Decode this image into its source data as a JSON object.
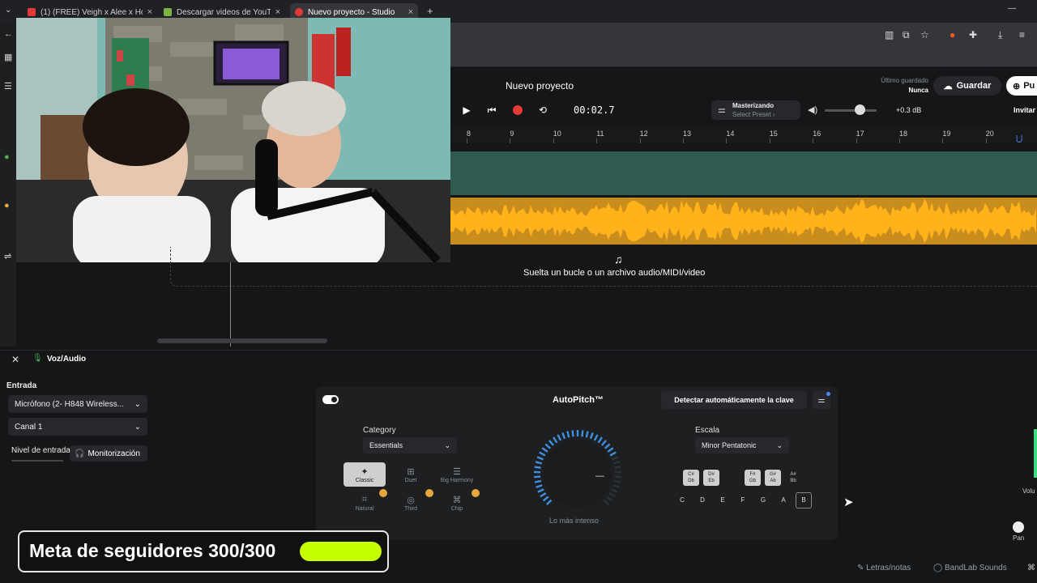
{
  "browser": {
    "tabs": [
      {
        "title": "(1) (FREE) Veigh x Alee x Hoodtr...",
        "close": "×"
      },
      {
        "title": "Descargar videos de YouTube - ...",
        "close": "×"
      },
      {
        "title": "Nuevo proyecto - Studio",
        "close": "×"
      }
    ],
    "new_tab": "+",
    "menu_arrow": "⌄",
    "minimize": "—"
  },
  "daw": {
    "project_title": "Nuevo proyecto",
    "time": "00:02.7",
    "mastering": {
      "title": "Masterizando",
      "preset": "Select Preset ›"
    },
    "volume_db": "+0.3 dB",
    "last_saved_label": "Último guardado",
    "last_saved_value": "Nunca",
    "save_label": "Guardar",
    "publish_label": "Pu",
    "invite_label": "Invitar",
    "ruler": [
      "8",
      "9",
      "10",
      "11",
      "12",
      "13",
      "14",
      "15",
      "16",
      "17",
      "18",
      "19",
      "20"
    ],
    "drop_text": "Suelta un bucle o un archivo audio/MIDI/video"
  },
  "panel": {
    "title": "Voz/Audio",
    "input_label": "Entrada",
    "mic_select": "Micrófono (2- H848 Wireless...",
    "channel_select": "Canal 1",
    "level_label": "Nivel de entrada",
    "monitor_label": "Monitorización"
  },
  "autopitch": {
    "title": "AutoPitch™",
    "detect_label": "Detectar automáticamente la clave",
    "category_label": "Category",
    "category_value": "Essentials",
    "presets": [
      "Classic",
      "Duet",
      "Big Harmony",
      "Natural",
      "Third",
      "Chip"
    ],
    "knob_label": "Lo más intenso",
    "knob_value": "—",
    "scale_label": "Escala",
    "scale_value": "Minor Pentatonic",
    "sharp_keys": [
      "C#\nDb",
      "D#\nEb",
      "F#\nGb",
      "G#\nAb",
      "A#\nBb"
    ],
    "keys": [
      "C",
      "D",
      "E",
      "F",
      "G",
      "A",
      "B"
    ]
  },
  "overlay": {
    "goal_text": "Meta de seguidores 300/300",
    "goal_progress": 1.0
  },
  "footer": {
    "lyrics": "Letras/notas",
    "sounds": "BandLab Sounds",
    "pan": "Pan",
    "vol": "Volu"
  },
  "colors": {
    "track_green": "#2f5a4f",
    "track_orange": "#c98d1e",
    "waveform": "#ffb21a",
    "accent_red": "#e53935",
    "goal_bar": "#c6ff00"
  }
}
